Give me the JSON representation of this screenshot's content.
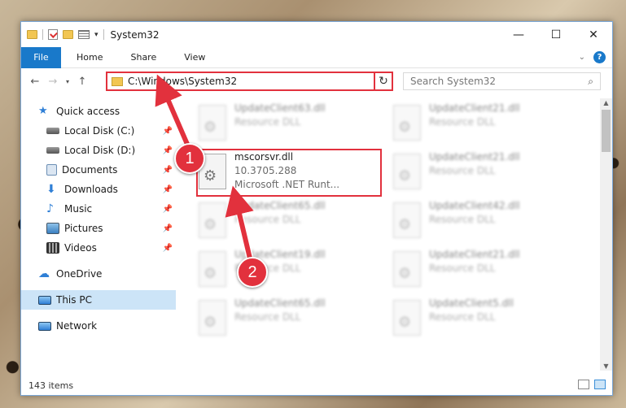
{
  "window": {
    "title": "System32",
    "caption": {
      "minimize": "—",
      "maximize": "☐",
      "close": "✕"
    }
  },
  "ribbon": {
    "file": "File",
    "tabs": [
      "Home",
      "Share",
      "View"
    ],
    "help": "?"
  },
  "nav": {
    "back": "←",
    "forward": "→",
    "recent": "▾",
    "up": "↑",
    "address": "C:\\Windows\\System32",
    "refresh": "↻",
    "search_placeholder": "Search System32"
  },
  "sidebar": {
    "items": [
      {
        "label": "Quick access",
        "icon": "star-icon",
        "color": "#2f7fd6"
      },
      {
        "label": "Local Disk (C:)",
        "icon": "drive-icon",
        "color": "#6d6d6d",
        "pinned": true
      },
      {
        "label": "Local Disk (D:)",
        "icon": "drive-icon",
        "color": "#6d6d6d",
        "pinned": true
      },
      {
        "label": "Documents",
        "icon": "documents-icon",
        "color": "#6c8fb5",
        "pinned": true
      },
      {
        "label": "Downloads",
        "icon": "download-icon",
        "color": "#2f7fd6",
        "pinned": true
      },
      {
        "label": "Music",
        "icon": "music-icon",
        "color": "#2f7fd6",
        "pinned": true
      },
      {
        "label": "Pictures",
        "icon": "pictures-icon",
        "color": "#4a90c9",
        "pinned": true
      },
      {
        "label": "Videos",
        "icon": "videos-icon",
        "color": "#555555",
        "pinned": true
      },
      {
        "label": "OneDrive",
        "icon": "cloud-icon",
        "color": "#2f7fd6"
      },
      {
        "label": "This PC",
        "icon": "computer-icon",
        "color": "#3d8fd6",
        "selected": true
      },
      {
        "label": "Network",
        "icon": "network-icon",
        "color": "#3d8fd6"
      }
    ]
  },
  "files": [
    {
      "name": "UpdateClient63.dll",
      "type": "Resource DLL",
      "blurred": true
    },
    {
      "name": "UpdateClient21.dll",
      "type": "Resource DLL",
      "blurred": true
    },
    {
      "name": "mscorsvr.dll",
      "type": "10.3705.288",
      "desc": "Microsoft .NET Runt...",
      "blurred": false
    },
    {
      "name": "UpdateClient21.dll",
      "type": "Resource DLL",
      "blurred": true
    },
    {
      "name": "UpdateClient65.dll",
      "type": "Resource DLL",
      "blurred": true
    },
    {
      "name": "UpdateClient42.dll",
      "type": "Resource DLL",
      "blurred": true
    },
    {
      "name": "UpdateClient19.dll",
      "type": "Resource DLL",
      "blurred": true
    },
    {
      "name": "UpdateClient21.dll",
      "type": "Resource DLL",
      "blurred": true
    },
    {
      "name": "UpdateClient65.dll",
      "type": "Resource DLL",
      "blurred": true
    },
    {
      "name": "UpdateClient5.dll",
      "type": "Resource DLL",
      "blurred": true
    }
  ],
  "status": {
    "count": "143 items"
  },
  "annotations": {
    "step1": "1",
    "step2": "2"
  },
  "colors": {
    "accent": "#1979ca",
    "highlight": "#e2313d",
    "selected": "#cce4f7"
  }
}
